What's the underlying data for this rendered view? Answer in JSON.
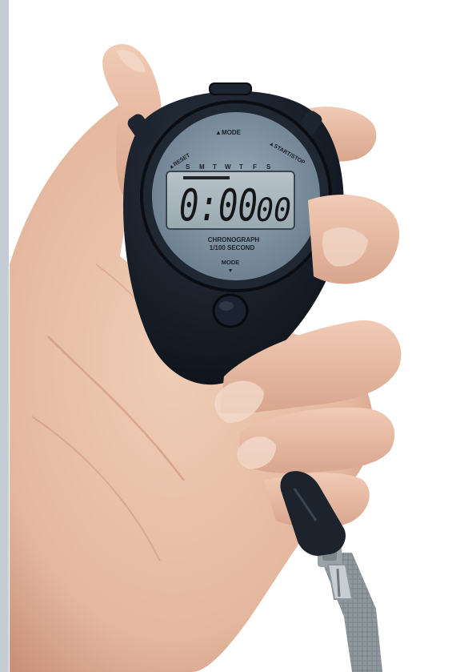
{
  "stopwatch": {
    "mode_top_label": "▲MODE",
    "reset_label": "▲RESET",
    "start_stop_label": "▲START/STOP",
    "weekdays": [
      "S",
      "M",
      "T",
      "W",
      "T",
      "F",
      "S"
    ],
    "time_main": "0:00",
    "time_hundredths": "00",
    "chronograph_label": "CHRONOGRAPH",
    "precision_label": "1/100 SECOND",
    "mode_bottom_label": "MODE",
    "mode_bottom_arrow": "▼"
  },
  "colors": {
    "background": "#ffffff",
    "left_frame": "#c4cdd6",
    "skin": "#e9c2ab",
    "skin_shadow": "#d29f88",
    "body": "#141a24",
    "bezel": "#1f2733",
    "dial": "#7f93a3",
    "lcd": "#a9b7bf",
    "digits": "#141617",
    "lanyard": "#8b9499"
  }
}
